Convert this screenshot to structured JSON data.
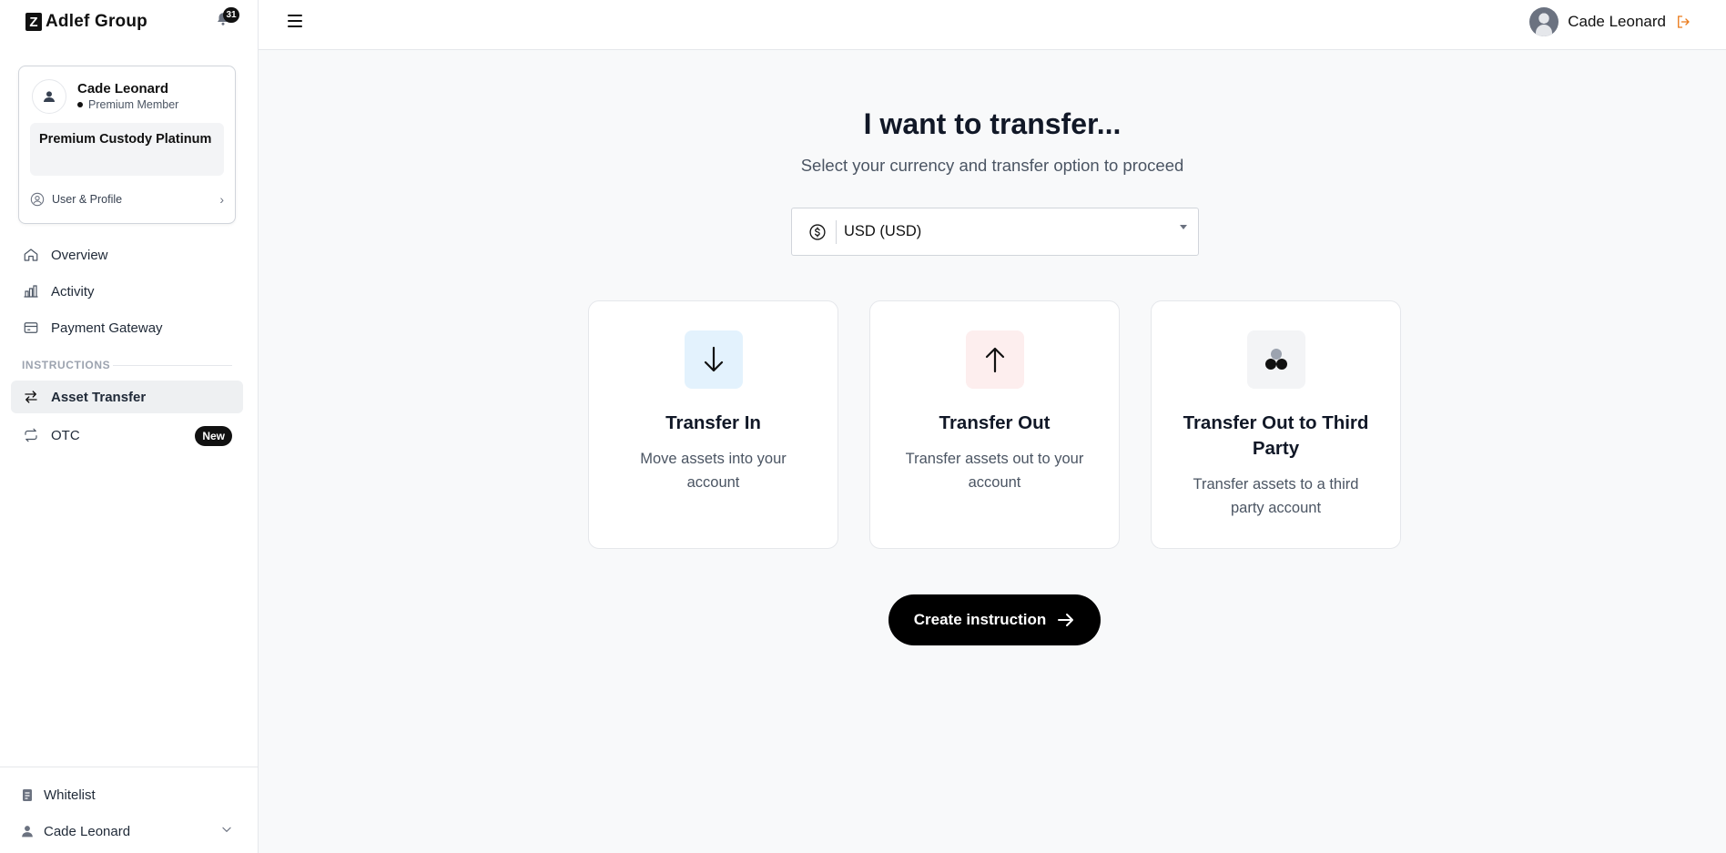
{
  "app": {
    "brand_mark": "Z",
    "brand_name": "Adlef Group",
    "notification_count": "31"
  },
  "profile_card": {
    "name": "Cade Leonard",
    "tier": "Premium Member",
    "plan": "Premium Custody Platinum",
    "link_label": "User & Profile"
  },
  "nav": {
    "overview": "Overview",
    "activity": "Activity",
    "payment_gateway": "Payment Gateway",
    "section_label": "INSTRUCTIONS",
    "asset_transfer": "Asset Transfer",
    "otc": "OTC",
    "otc_badge": "New"
  },
  "sidebar_bottom": {
    "whitelist": "Whitelist",
    "user": "Cade Leonard"
  },
  "topbar": {
    "user_name": "Cade Leonard"
  },
  "main": {
    "heading": "I want to transfer...",
    "subheading": "Select your currency and transfer option to proceed",
    "currency_value": "USD (USD)",
    "options": [
      {
        "title": "Transfer In",
        "description": "Move assets into your account",
        "icon": "arrow-down-icon",
        "tile_color": "#e3f2fd"
      },
      {
        "title": "Transfer Out",
        "description": "Transfer assets out to your account",
        "icon": "arrow-up-icon",
        "tile_color": "#fdeeee"
      },
      {
        "title": "Transfer Out to Third Party",
        "description": "Transfer assets to a third party account",
        "icon": "third-party-icon",
        "tile_color": "#f3f4f6"
      }
    ],
    "cta_label": "Create instruction"
  },
  "colors": {
    "accent": "#000000",
    "logout_icon": "#ea7a1a"
  }
}
